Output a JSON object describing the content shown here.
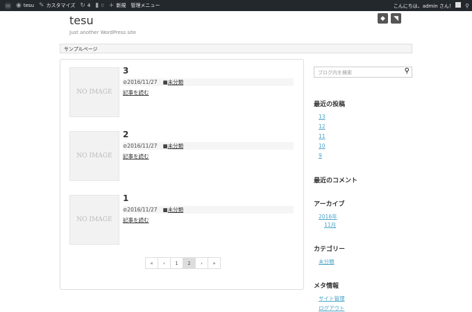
{
  "adminbar": {
    "site": "tesu",
    "customize": "カスタマイズ",
    "updates": "4",
    "comments": "0",
    "new": "新規",
    "admin_menu": "管理メニュー",
    "greeting": "こんにちは、admin さん！"
  },
  "header": {
    "title": "tesu",
    "tagline": "Just another WordPress site"
  },
  "nav": {
    "items": [
      "サンプルページ"
    ]
  },
  "posts": [
    {
      "title": "3",
      "date": "2016/11/27",
      "category": "未分類",
      "more": "記事を読む",
      "thumb": "NO IMAGE"
    },
    {
      "title": "2",
      "date": "2016/11/27",
      "category": "未分類",
      "more": "記事を読む",
      "thumb": "NO IMAGE"
    },
    {
      "title": "1",
      "date": "2016/11/27",
      "category": "未分類",
      "more": "記事を読む",
      "thumb": "NO IMAGE"
    }
  ],
  "pagination": {
    "first": "«",
    "prev": "‹",
    "pages": [
      "1",
      "2"
    ],
    "current": "2",
    "next": "›",
    "last": "»"
  },
  "sidebar": {
    "search_placeholder": "ブログ内を検索",
    "recent_posts": {
      "title": "最近の投稿",
      "items": [
        "13",
        "12",
        "11",
        "10",
        "9"
      ]
    },
    "recent_comments": {
      "title": "最近のコメント"
    },
    "archives": {
      "title": "アーカイブ",
      "year": "2016年",
      "month": "11月"
    },
    "categories": {
      "title": "カテゴリー",
      "items": [
        "未分類"
      ]
    },
    "meta": {
      "title": "メタ情報",
      "items": [
        "サイト管理",
        "ログアウト"
      ]
    }
  }
}
